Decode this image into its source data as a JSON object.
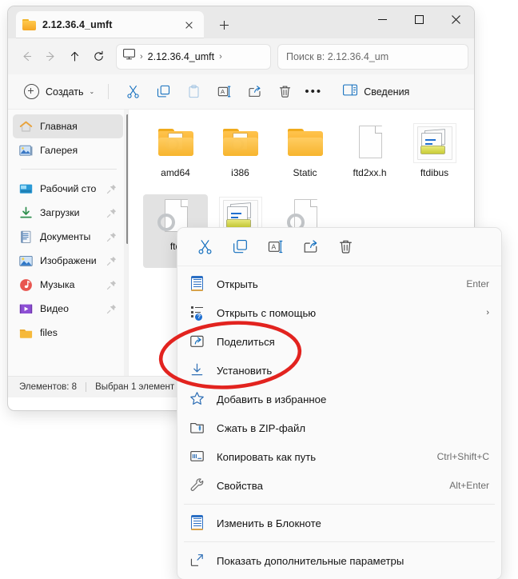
{
  "window": {
    "tab_title": "2.12.36.4_umft",
    "tab_close_label": "✕",
    "new_tab_label": "+",
    "minimize_label": "minimize",
    "maximize_label": "maximize",
    "close_label": "close"
  },
  "navbar": {
    "back_icon": "back-arrow-icon",
    "forward_icon": "forward-arrow-icon",
    "up_icon": "up-arrow-icon",
    "refresh_icon": "refresh-icon",
    "breadcrumb_root_icon": "this-pc-icon",
    "breadcrumb_sep": "›",
    "breadcrumb_current": "2.12.36.4_umft",
    "search_placeholder": "Поиск в: 2.12.36.4_um"
  },
  "commandbar": {
    "new_label": "Создать",
    "new_chevron": "⌄",
    "cut_icon": "cut-icon",
    "copy_icon": "copy-icon",
    "paste_icon": "paste-icon",
    "rename_icon": "rename-icon",
    "share_icon": "share-icon",
    "delete_icon": "delete-icon",
    "more_label": "•••",
    "details_label": "Сведения",
    "details_icon": "details-pane-icon"
  },
  "sidebar": {
    "items": [
      {
        "label": "Главная",
        "icon": "home-icon",
        "pinned": false,
        "selected": true
      },
      {
        "label": "Галерея",
        "icon": "gallery-icon",
        "pinned": false,
        "selected": false
      },
      {
        "label": "Рабочий сто",
        "icon": "desktop-icon",
        "pinned": true,
        "selected": false
      },
      {
        "label": "Загрузки",
        "icon": "downloads-icon",
        "pinned": true,
        "selected": false
      },
      {
        "label": "Документы",
        "icon": "documents-icon",
        "pinned": true,
        "selected": false
      },
      {
        "label": "Изображени",
        "icon": "pictures-icon",
        "pinned": true,
        "selected": false
      },
      {
        "label": "Музыка",
        "icon": "music-icon",
        "pinned": true,
        "selected": false
      },
      {
        "label": "Видео",
        "icon": "videos-icon",
        "pinned": true,
        "selected": false
      },
      {
        "label": "files",
        "icon": "folder-icon",
        "pinned": false,
        "selected": false
      }
    ]
  },
  "files": [
    {
      "name": "amd64",
      "type": "folder",
      "selected": false,
      "boxed": false
    },
    {
      "name": "i386",
      "type": "folder",
      "selected": false,
      "boxed": false
    },
    {
      "name": "Static",
      "type": "folder-plain",
      "selected": false,
      "boxed": false
    },
    {
      "name": "ftd2xx.h",
      "type": "document",
      "selected": false,
      "boxed": false
    },
    {
      "name": "ftdibus",
      "type": "inf",
      "selected": false,
      "boxed": true
    },
    {
      "name": "ftd",
      "type": "document-gear",
      "selected": true,
      "boxed": false
    },
    {
      "name": "",
      "type": "inf",
      "selected": false,
      "boxed": true
    },
    {
      "name": "",
      "type": "document-gear",
      "selected": false,
      "boxed": false
    }
  ],
  "statusbar": {
    "count_label": "Элементов: 8",
    "selection_label": "Выбран 1 элемент"
  },
  "context_menu": {
    "toolbar": [
      {
        "icon": "cut-icon",
        "name": "cut"
      },
      {
        "icon": "copy-icon",
        "name": "copy"
      },
      {
        "icon": "rename-icon",
        "name": "rename"
      },
      {
        "icon": "share-icon",
        "name": "share"
      },
      {
        "icon": "delete-icon",
        "name": "delete"
      }
    ],
    "items": [
      {
        "label": "Открыть",
        "icon": "notepad-icon",
        "accel": "Enter",
        "submenu": false
      },
      {
        "label": "Открыть с помощью",
        "icon": "open-with-icon",
        "accel": "",
        "submenu": true
      },
      {
        "label": "Поделиться",
        "icon": "share-icon",
        "accel": "",
        "submenu": false
      },
      {
        "label": "Установить",
        "icon": "install-icon",
        "accel": "",
        "submenu": false
      },
      {
        "label": "Добавить в избранное",
        "icon": "star-icon",
        "accel": "",
        "submenu": false
      },
      {
        "label": "Сжать в ZIP-файл",
        "icon": "zip-icon",
        "accel": "",
        "submenu": false
      },
      {
        "label": "Копировать как путь",
        "icon": "copy-path-icon",
        "accel": "Ctrl+Shift+C",
        "submenu": false
      },
      {
        "label": "Свойства",
        "icon": "wrench-icon",
        "accel": "Alt+Enter",
        "submenu": false
      },
      {
        "label": "Изменить в Блокноте",
        "icon": "notepad-icon",
        "accel": "",
        "submenu": false
      },
      {
        "label": "Показать дополнительные параметры",
        "icon": "expand-icon",
        "accel": "",
        "submenu": false
      }
    ],
    "divider_after": [
      7,
      8
    ]
  },
  "annotation": {
    "shape": "ellipse",
    "color": "#e2231f",
    "targets_label": "Установить"
  },
  "colors": {
    "accent": "#0f6cbd",
    "annotation_red": "#e2231f",
    "folder_yellow": "#f5a623",
    "titlebar_bg": "#e9e9e9",
    "window_bg": "#ffffff"
  }
}
